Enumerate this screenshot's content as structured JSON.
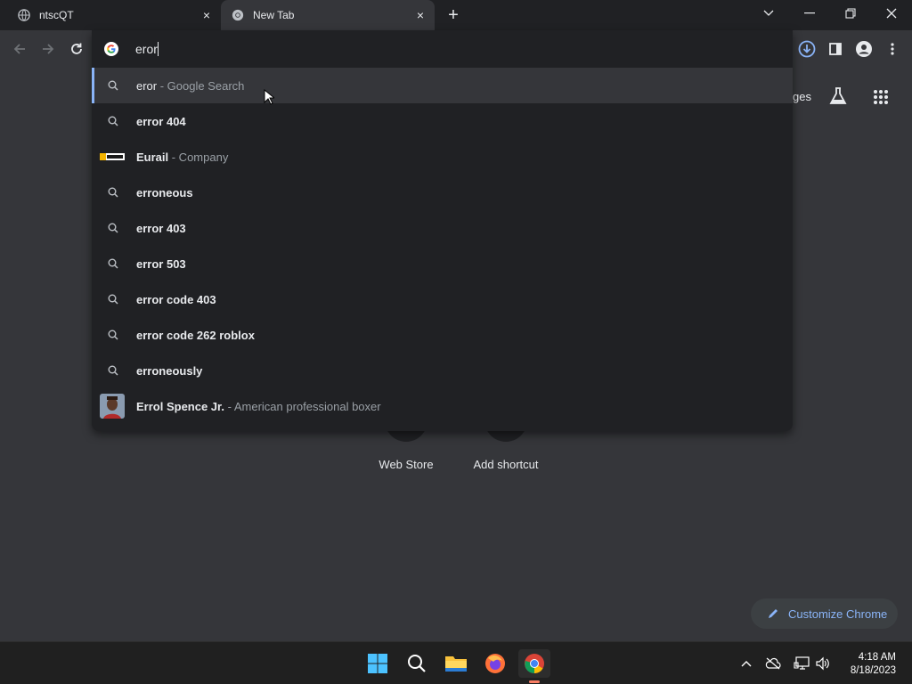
{
  "tabs": [
    {
      "title": "ntscQT",
      "close": "×"
    },
    {
      "title": "New Tab",
      "close": "×"
    }
  ],
  "new_tab_symbol": "+",
  "window_controls": {
    "dropdown": "⌄",
    "minimize": "—",
    "maximize": "❐",
    "close": "✕"
  },
  "omnibox": {
    "typed": "eror"
  },
  "suggestions": [
    {
      "main": "eror",
      "sub": " - Google Search",
      "icon": "search-icon",
      "bold": false,
      "selected": true
    },
    {
      "main": "error 404",
      "sub": "",
      "icon": "search-icon",
      "bold": true
    },
    {
      "main": "Eurail",
      "sub": " - Company",
      "icon": "eurail-logo",
      "bold": true
    },
    {
      "main": "erroneous",
      "sub": "",
      "icon": "search-icon",
      "bold": true
    },
    {
      "main": "error 403",
      "sub": "",
      "icon": "search-icon",
      "bold": true
    },
    {
      "main": "error 503",
      "sub": "",
      "icon": "search-icon",
      "bold": true
    },
    {
      "main": "error code 403",
      "sub": "",
      "icon": "search-icon",
      "bold": true
    },
    {
      "main": "error code 262 roblox",
      "sub": "",
      "icon": "search-icon",
      "bold": true
    },
    {
      "main": "erroneously",
      "sub": "",
      "icon": "search-icon",
      "bold": true
    },
    {
      "main": "Errol Spence Jr.",
      "sub": " - American professional boxer",
      "icon": "person-thumbnail",
      "bold": true
    }
  ],
  "ntp": {
    "images_link_partial": "ges",
    "shortcuts": [
      "Web Store",
      "Add shortcut"
    ],
    "customize_label": "Customize Chrome"
  },
  "taskbar": {
    "time": "4:18 AM",
    "date": "8/18/2023"
  },
  "colors": {
    "accent": "#8ab4f8",
    "bg": "#35363a",
    "omnibox_bg": "#202124"
  }
}
